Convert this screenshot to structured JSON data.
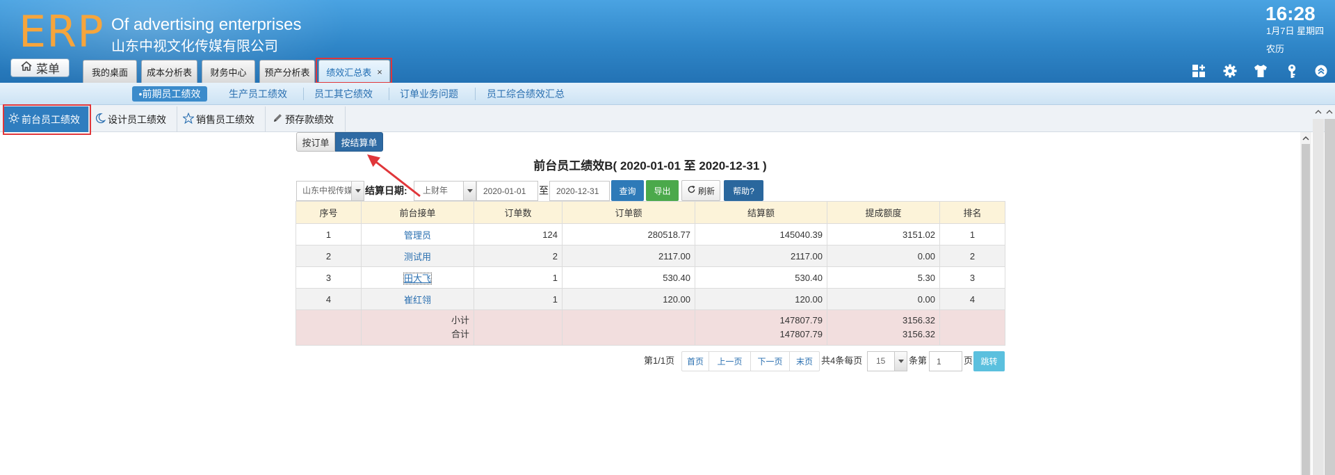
{
  "colors": {
    "header": "#2f86c8",
    "logo": "#f6a53c",
    "active_tab": "#2f7dbf",
    "highlight_border": "#e0363a",
    "query_button": "#2e7ab8",
    "export_button": "#4ba94b",
    "help_button": "#2a679d",
    "jump_button": "#5bc0de",
    "table_header": "#fcf3d9",
    "summary_row": "#f2dede",
    "link": "#2a6fb0"
  },
  "brand": {
    "logo": "ERP",
    "tagline": "Of advertising enterprises",
    "company": "山东中视文化传媒有限公司"
  },
  "clock": {
    "time": "16:28",
    "date": "1月7日 星期四",
    "lunar": "农历"
  },
  "menu_button": {
    "label": "菜单",
    "icon": "home-icon"
  },
  "top_tabs": [
    {
      "label": "我的桌面"
    },
    {
      "label": "成本分析表"
    },
    {
      "label": "财务中心"
    },
    {
      "label": "预产分析表"
    },
    {
      "label": "绩效汇总表",
      "close": "×",
      "active": true
    }
  ],
  "toolbar_icons": [
    "grid-plus-icon",
    "gear-icon",
    "shirt-icon",
    "key-icon",
    "chevron-up-circle-icon"
  ],
  "sub_nav": [
    {
      "label": "•前期员工绩效",
      "active": true
    },
    {
      "label": "生产员工绩效"
    },
    {
      "label": "员工其它绩效"
    },
    {
      "label": "订单业务问题"
    },
    {
      "label": "员工综合绩效汇总"
    }
  ],
  "section_tabs": [
    {
      "label": "前台员工绩效",
      "icon": "sun-icon",
      "active": true
    },
    {
      "label": "设计员工绩效",
      "icon": "moon-icon"
    },
    {
      "label": "销售员工绩效",
      "icon": "star-icon"
    },
    {
      "label": "预存款绩效",
      "icon": "pencil-icon"
    }
  ],
  "mode_toggle": {
    "by_order": "按订单",
    "by_settlement": "按结算单",
    "by_settlement_active": true
  },
  "report_title": "前台员工绩效B( 2020-01-01 至 2020-12-31 )",
  "filters": {
    "company_select": "山东中视传媒",
    "date_label": "结算日期:",
    "period_select": "上财年",
    "start_date": "2020-01-01",
    "to": "至",
    "end_date": "2020-12-31",
    "query": "查询",
    "export": "导出",
    "refresh": "刷新",
    "help": "帮助?"
  },
  "table": {
    "headers": [
      "序号",
      "前台接单",
      "订单数",
      "订单额",
      "结算额",
      "提成额度",
      "排名"
    ],
    "rows": [
      {
        "no": "1",
        "staff": "管理员",
        "order_count": "124",
        "order_amount": "280518.77",
        "settled_amount": "145040.39",
        "commission": "3151.02",
        "rank": "1"
      },
      {
        "no": "2",
        "staff": "测试用",
        "order_count": "2",
        "order_amount": "2117.00",
        "settled_amount": "2117.00",
        "commission": "0.00",
        "rank": "2"
      },
      {
        "no": "3",
        "staff": "田大飞",
        "order_count": "1",
        "order_amount": "530.40",
        "settled_amount": "530.40",
        "commission": "5.30",
        "rank": "3"
      },
      {
        "no": "4",
        "staff": "崔红翎",
        "order_count": "1",
        "order_amount": "120.00",
        "settled_amount": "120.00",
        "commission": "0.00",
        "rank": "4"
      }
    ],
    "summary": {
      "subtotal_label": "小计",
      "total_label": "合计",
      "settled_subtotal": "147807.79",
      "settled_total": "147807.79",
      "commission_subtotal": "3156.32",
      "commission_total": "3156.32"
    }
  },
  "pagination": {
    "page_info": "第1/1页",
    "first": "首页",
    "prev": "上一页",
    "next": "下一页",
    "last": "末页",
    "total_per_page": "共4条每页",
    "page_size": "15",
    "goto_prefix": "条第",
    "page_number": "1",
    "goto_suffix": "页",
    "jump": "跳转"
  }
}
